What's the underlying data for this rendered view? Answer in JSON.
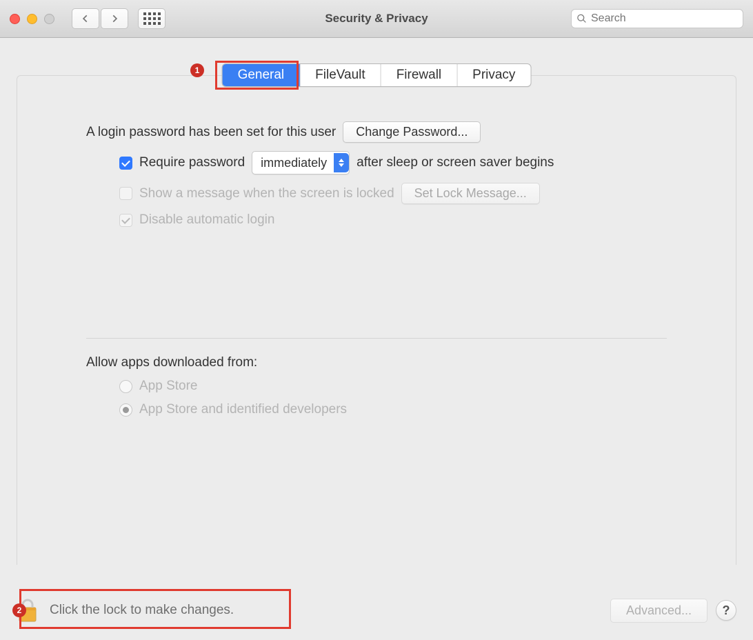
{
  "titlebar": {
    "title": "Security & Privacy"
  },
  "search": {
    "placeholder": "Search"
  },
  "tabs": {
    "general": "General",
    "filevault": "FileVault",
    "firewall": "Firewall",
    "privacy": "Privacy"
  },
  "general": {
    "password_set_text": "A login password has been set for this user",
    "change_password_btn": "Change Password...",
    "require_password_label": "Require password",
    "require_password_delay": "immediately",
    "require_password_suffix": "after sleep or screen saver begins",
    "show_message_label": "Show a message when the screen is locked",
    "set_lock_message_btn": "Set Lock Message...",
    "disable_auto_login_label": "Disable automatic login",
    "allow_apps_header": "Allow apps downloaded from:",
    "radio_app_store": "App Store",
    "radio_identified": "App Store and identified developers"
  },
  "bottom": {
    "lock_text": "Click the lock to make changes.",
    "advanced_btn": "Advanced...",
    "help_btn": "?"
  },
  "annotations": {
    "one": "1",
    "two": "2"
  }
}
